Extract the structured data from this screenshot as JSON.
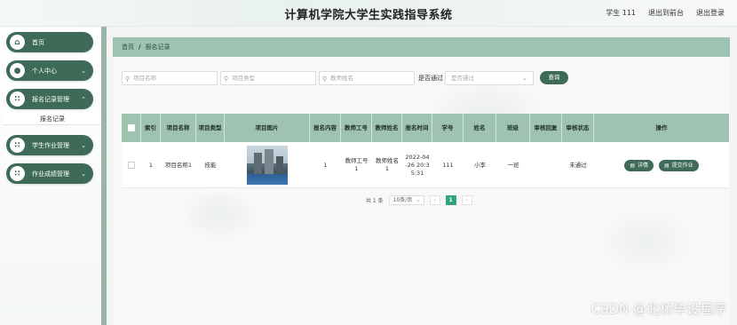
{
  "header": {
    "title": "计算机学院大学生实践指导系统",
    "user": "学生 111",
    "back_to_front": "退出到前台",
    "logout": "退出登录"
  },
  "sidebar": {
    "items": [
      {
        "label": "首页",
        "icon": "home-icon",
        "expandable": false
      },
      {
        "label": "个人中心",
        "icon": "person-icon",
        "expandable": true
      },
      {
        "label": "报名记录管理",
        "icon": "grid-icon",
        "expandable": true
      },
      {
        "label": "学生作业管理",
        "icon": "grid-icon",
        "expandable": true
      },
      {
        "label": "作业成绩管理",
        "icon": "grid-icon",
        "expandable": true
      }
    ],
    "submenu": {
      "label": "报名记录"
    }
  },
  "breadcrumb": {
    "home": "首页",
    "separator": "/",
    "current": "报名记录"
  },
  "search": {
    "project_name_placeholder": "项目名称",
    "project_type_placeholder": "项目类型",
    "teacher_name_placeholder": "教师姓名",
    "approved_label": "是否通过",
    "approved_placeholder": "是否通过",
    "query_button": "查询"
  },
  "table": {
    "columns": [
      "索引",
      "项目名称",
      "项目类型",
      "项目图片",
      "报名内容",
      "教师工号",
      "教师姓名",
      "报名时间",
      "学号",
      "姓名",
      "班级",
      "审核回复",
      "审核状态",
      "操作"
    ],
    "rows": [
      {
        "index": "1",
        "project_name": "项目名称1",
        "project_type": "技能",
        "content": "1",
        "teacher_id": "教师工号1",
        "teacher_name": "教师姓名1",
        "signup_time": "2022-04-26 20:35:31",
        "student_id": "111",
        "student_name": "小李",
        "class": "一班",
        "review_reply": "",
        "review_status": "未通过",
        "actions": {
          "detail": "详情",
          "submit": "提交作业"
        }
      }
    ]
  },
  "pagination": {
    "total": "共 1 条",
    "page_size": "10条/页",
    "prev": "‹",
    "current": "1",
    "next": "›"
  },
  "watermark": "CSDN @北桥毕设程序",
  "colors": {
    "primary": "#3d6b57",
    "header_row": "#9ec4b1",
    "page_active": "#2fa57a"
  }
}
